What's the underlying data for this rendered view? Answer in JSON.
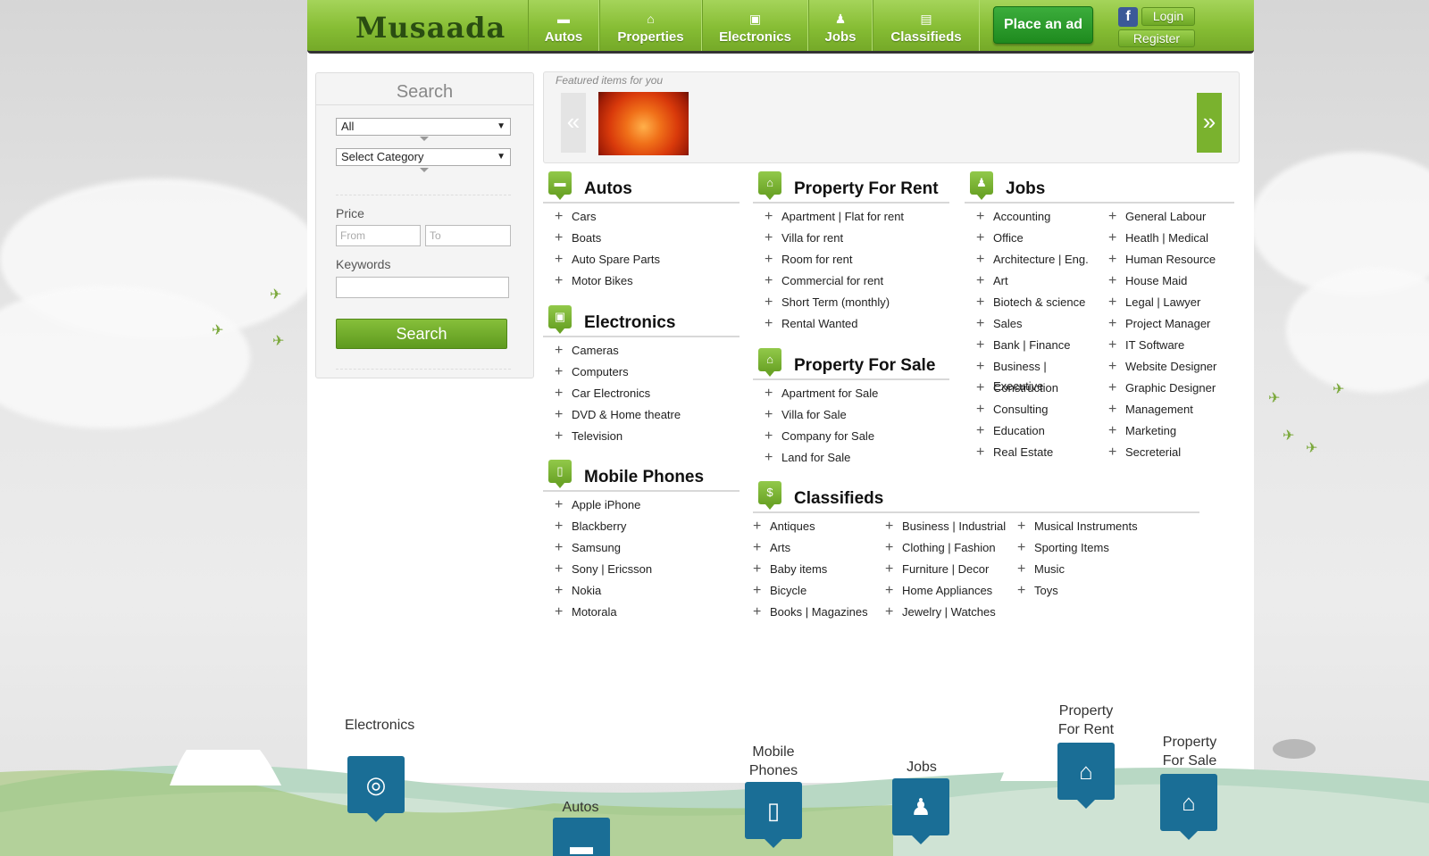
{
  "brand": {
    "logo": "Musaada",
    "accent": "#86bd34",
    "marker": "#1a6e96"
  },
  "nav": {
    "items": [
      {
        "label": "Autos",
        "icon": "car-icon"
      },
      {
        "label": "Properties",
        "icon": "house-icon"
      },
      {
        "label": "Electronics",
        "icon": "speaker-icon"
      },
      {
        "label": "Jobs",
        "icon": "person-icon"
      },
      {
        "label": "Classifieds",
        "icon": "register-icon"
      }
    ],
    "place_ad": "Place an ad",
    "facebook": "f",
    "login": "Login",
    "register": "Register"
  },
  "search": {
    "title": "Search",
    "select_all": "All",
    "select_category": "Select Category",
    "price_label": "Price",
    "price_from_placeholder": "From",
    "price_to_placeholder": "To",
    "keywords_label": "Keywords",
    "button": "Search"
  },
  "featured": {
    "label": "Featured items for you",
    "prev": "«",
    "next": "»"
  },
  "categories": {
    "autos": {
      "title": "Autos",
      "items": [
        "Cars",
        "Boats",
        "Auto Spare Parts",
        "Motor Bikes"
      ]
    },
    "electronics": {
      "title": "Electronics",
      "items": [
        "Cameras",
        "Computers",
        "Car Electronics",
        "DVD & Home theatre",
        "Television"
      ]
    },
    "mobile": {
      "title": "Mobile Phones",
      "items": [
        "Apple iPhone",
        "Blackberry",
        "Samsung",
        "Sony | Ericsson",
        "Nokia",
        "Motorala"
      ]
    },
    "rent": {
      "title": "Property For Rent",
      "items": [
        "Apartment | Flat for rent",
        "Villa for rent",
        "Room for rent",
        "Commercial for rent",
        "Short Term (monthly)",
        "Rental Wanted"
      ]
    },
    "sale": {
      "title": "Property For Sale",
      "items": [
        "Apartment for Sale",
        "Villa for Sale",
        "Company for Sale",
        "Land for Sale"
      ]
    },
    "jobs": {
      "title": "Jobs",
      "col1": [
        "Accounting",
        "Office",
        "Architecture | Eng.",
        "Art",
        "Biotech & science",
        "Sales",
        "Bank | Finance",
        "Business | Executive",
        "Construction",
        "Consulting",
        "Education",
        "Real Estate"
      ],
      "col2": [
        "General Labour",
        "Heatlh | Medical",
        "Human Resource",
        "House Maid",
        "Legal | Lawyer",
        "Project Manager",
        "IT Software",
        "Website Designer",
        "Graphic Designer",
        "Management",
        "Marketing",
        "Secreterial"
      ]
    },
    "classifieds": {
      "title": "Classifieds",
      "col1": [
        "Antiques",
        "Arts",
        "Baby items",
        "Bicycle",
        "Books | Magazines"
      ],
      "col2": [
        "Business | Industrial",
        "Clothing | Fashion",
        "Furniture | Decor",
        "Home Appliances",
        "Jewelry | Watches"
      ],
      "col3": [
        "Musical Instruments",
        "Sporting Items",
        "Music",
        "Toys"
      ]
    }
  },
  "map": {
    "electronics": "Electronics",
    "autos": "Autos",
    "mobile_1": "Mobile",
    "mobile_2": "Phones",
    "jobs": "Jobs",
    "rent_1": "Property",
    "rent_2": "For Rent",
    "sale_1": "Property",
    "sale_2": "For Sale"
  }
}
